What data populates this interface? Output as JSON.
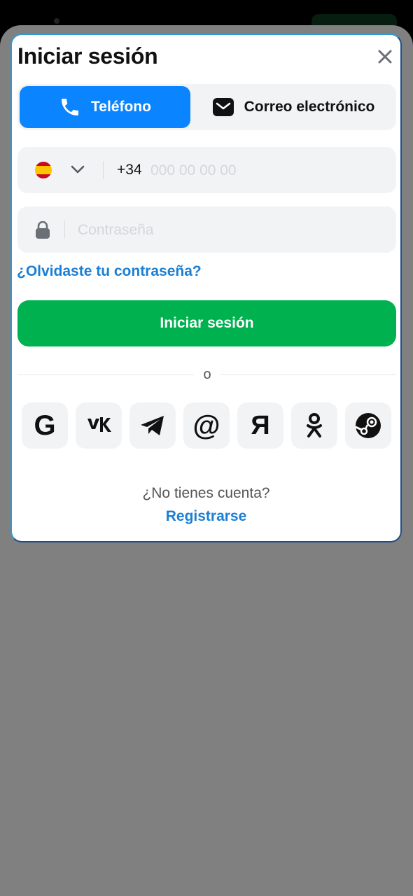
{
  "modal": {
    "title": "Iniciar sesión"
  },
  "tabs": [
    {
      "label": "Teléfono",
      "icon": "phone-icon",
      "active": true
    },
    {
      "label": "Correo electrónico",
      "icon": "mail-icon",
      "active": false
    }
  ],
  "phone": {
    "country_flag": "spain-flag-icon",
    "prefix": "+34",
    "placeholder": "000 00 00 00"
  },
  "password": {
    "placeholder": "Contraseña"
  },
  "forgot_label": "¿Olvidaste tu contraseña?",
  "submit_label": "Iniciar sesión",
  "separator_label": "o",
  "social": [
    {
      "name": "google",
      "icon": "google-icon",
      "glyph": "G"
    },
    {
      "name": "vk",
      "icon": "vk-icon",
      "glyph": ""
    },
    {
      "name": "telegram",
      "icon": "telegram-icon",
      "glyph": ""
    },
    {
      "name": "mail-ru",
      "icon": "at-sign-icon",
      "glyph": "@"
    },
    {
      "name": "yandex",
      "icon": "yandex-icon",
      "glyph": "Я"
    },
    {
      "name": "odnoklassniki",
      "icon": "odnoklassniki-icon",
      "glyph": ""
    },
    {
      "name": "steam",
      "icon": "steam-icon",
      "glyph": ""
    }
  ],
  "footer": {
    "no_account": "¿No tienes cuenta?",
    "register_label": "Registrarse"
  },
  "colors": {
    "accent": "#0a84ff",
    "primary_button": "#00b14f",
    "link": "#1a7fd4",
    "overlay": "#808080"
  }
}
